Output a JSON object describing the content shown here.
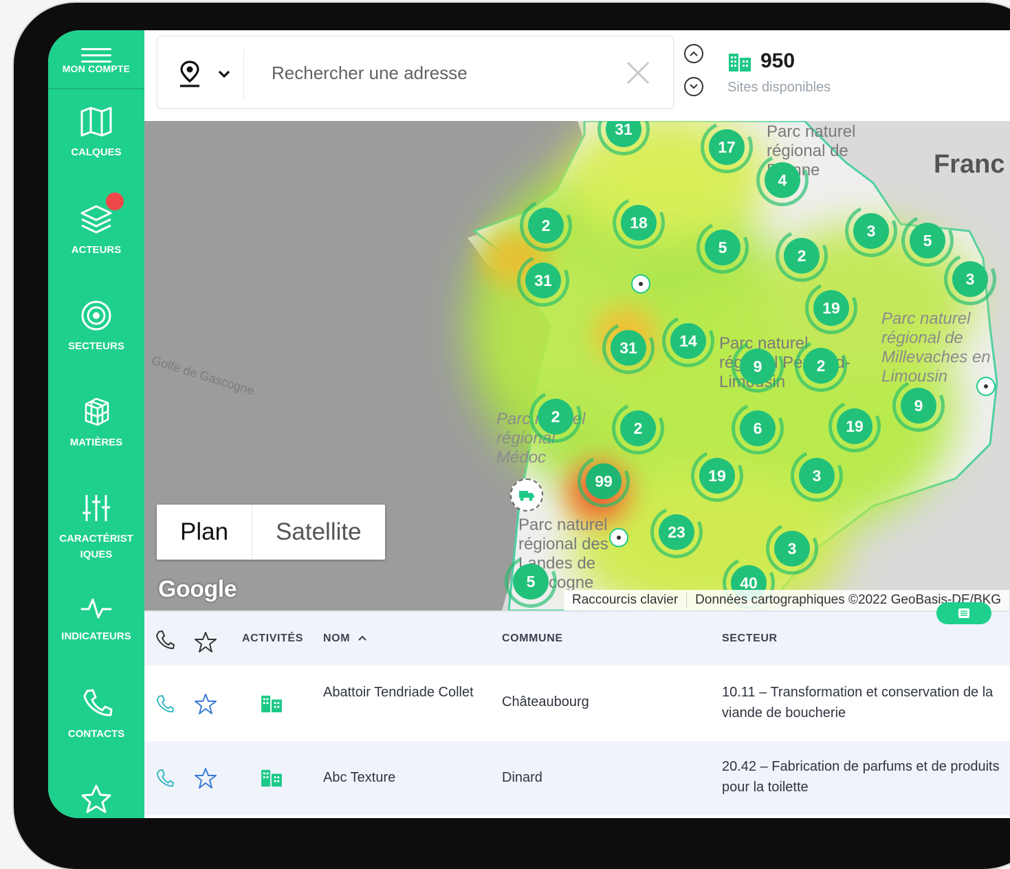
{
  "sidebar": {
    "account": "MON COMPTE",
    "items": [
      {
        "label": "CALQUES",
        "icon": "map-icon"
      },
      {
        "label": "ACTEURS",
        "icon": "layers-icon"
      },
      {
        "label": "SECTEURS",
        "icon": "target-icon"
      },
      {
        "label": "MATIÈRES",
        "icon": "cube-icon"
      },
      {
        "label": "CARACTÉRIST IQUES",
        "icon": "sliders-icon"
      },
      {
        "label": "INDICATEURS",
        "icon": "pulse-icon"
      },
      {
        "label": "CONTACTS",
        "icon": "phone-icon"
      }
    ]
  },
  "search": {
    "placeholder": "Rechercher une adresse"
  },
  "sites": {
    "count": "950",
    "label": "Sites disponibles"
  },
  "map": {
    "place_gulf": "Golfe de Gascogne",
    "place_country": "Franc",
    "place_brenne": "Parc naturel régional de Brenne",
    "place_millevaches": "Parc naturel régional de Millevaches en Limousin",
    "place_perigord": "Parc naturel régional Périgord-Limousin",
    "place_medoc": "Parc naturel régional Médoc",
    "place_landes": "Parc naturel régional des Landes de Gascogne",
    "clusters": [
      "31",
      "17",
      "4",
      "2",
      "18",
      "5",
      "2",
      "3",
      "5",
      "31",
      "3",
      "19",
      "31",
      "14",
      "9",
      "2",
      "2",
      "2",
      "6",
      "19",
      "9",
      "99",
      "19",
      "3",
      "23",
      "3",
      "40",
      "5"
    ],
    "map_type_plan": "Plan",
    "map_type_satellite": "Satellite",
    "google": "Google",
    "shortcuts": "Raccourcis clavier",
    "copyright": "Données cartographiques ©2022 GeoBasis-DE/BKG"
  },
  "table": {
    "headers": {
      "activites": "ACTIVITÉS",
      "nom": "NOM",
      "commune": "COMMUNE",
      "secteur": "SECTEUR"
    },
    "rows": [
      {
        "nom": "Abattoir Tendriade Collet",
        "commune": "Châteaubourg",
        "secteur": "10.11 – Transformation et conservation de la viande de boucherie"
      },
      {
        "nom": "Abc Texture",
        "commune": "Dinard",
        "secteur": "20.42 – Fabrication de parfums et de produits pour la toilette"
      }
    ]
  },
  "colors": {
    "brand": "#1ed08c",
    "badge": "#f04848"
  }
}
